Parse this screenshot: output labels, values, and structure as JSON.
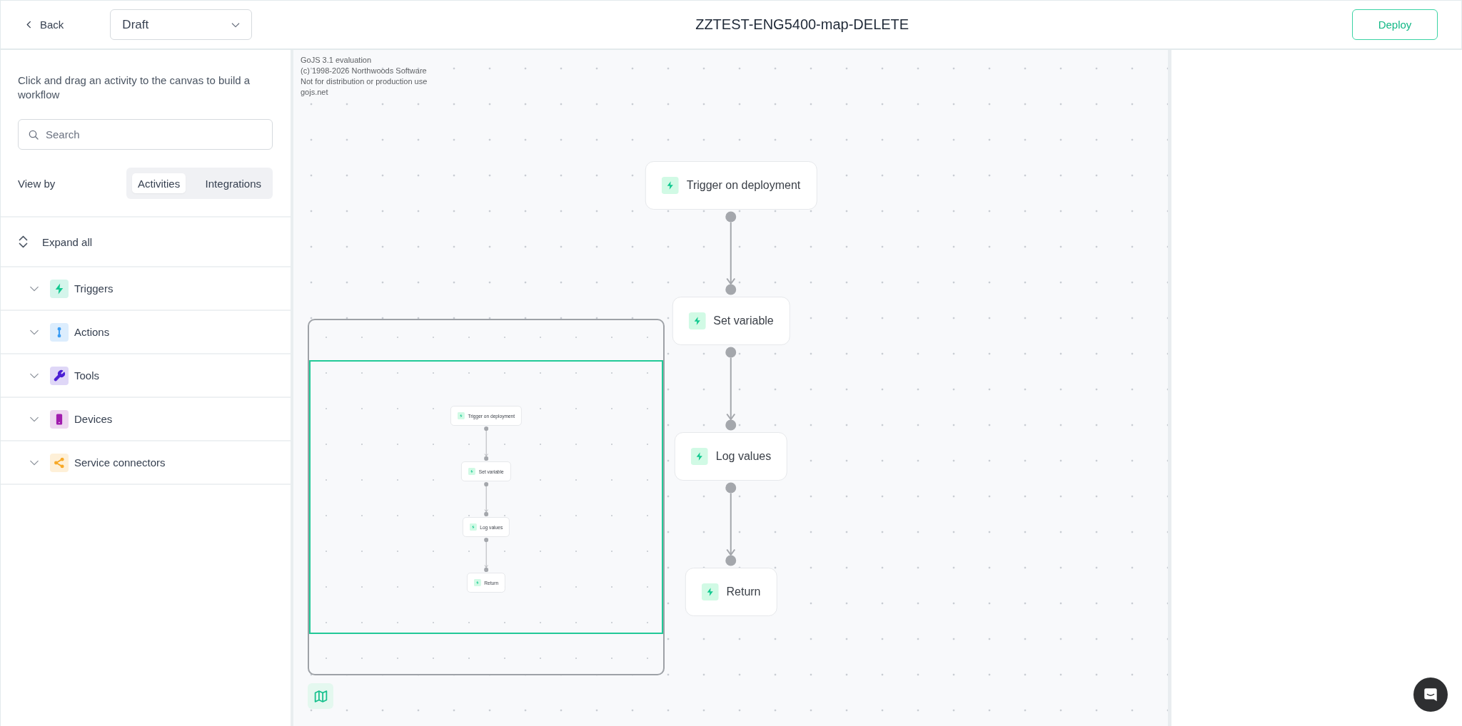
{
  "header": {
    "back": "Back",
    "status": "Draft",
    "title": "ZZTEST-ENG5400-map-DELETE",
    "deploy": "Deploy"
  },
  "sidebar": {
    "instructions": "Click and drag an activity to the canvas to build a workflow",
    "search": {
      "placeholder": "Search"
    },
    "view_by": {
      "label": "View by",
      "options": [
        {
          "label": "Activities",
          "selected": true
        },
        {
          "label": "Integrations",
          "selected": false
        }
      ]
    },
    "expand_all": "Expand all",
    "categories": [
      {
        "label": "Triggers",
        "color": "#10c98f",
        "expanded": false
      },
      {
        "label": "Actions",
        "color": "#3b9df5",
        "expanded": false
      },
      {
        "label": "Tools",
        "color": "#4c1fd4",
        "expanded": false
      },
      {
        "label": "Devices",
        "color": "#a11cae",
        "expanded": false
      },
      {
        "label": "Service connectors",
        "color": "#f7a928",
        "expanded": false
      }
    ]
  },
  "canvas": {
    "notice": [
      "GoJS 3.1 evaluation",
      "(c) 1998-2026 Northwoods Software",
      "Not for distribution or production use",
      "gojs.net"
    ],
    "nodes": [
      {
        "label": "Trigger on deployment"
      },
      {
        "label": "Set variable"
      },
      {
        "label": "Log values"
      },
      {
        "label": "Return"
      }
    ],
    "overview": {
      "nodes": [
        {
          "label": "Trigger on deployment"
        },
        {
          "label": "Set variable"
        },
        {
          "label": "Log values"
        },
        {
          "label": "Return"
        }
      ]
    }
  }
}
